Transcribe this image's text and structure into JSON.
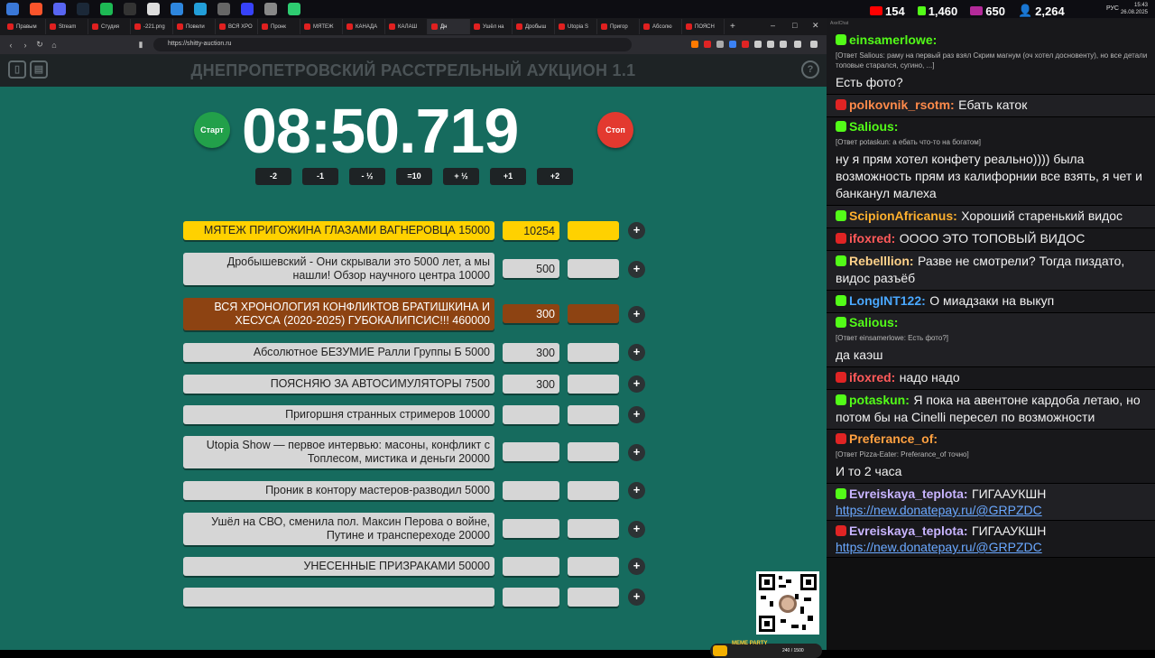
{
  "taskbar": {
    "clock": "15:43",
    "date": "26.08.2025",
    "lang": "РУС"
  },
  "browser": {
    "tabs": [
      "Правым",
      "Stream",
      "Студия",
      "-221.png",
      "Повели",
      "ВСЯ ХРО",
      "Пронк",
      "МЯТЕЖ",
      "КАНАДА",
      "КАЛАШ",
      "Дн",
      "Ушёл на",
      "Дробыш",
      "Utopia S",
      "Пригор",
      "Абсолю",
      "ПОЯСН"
    ],
    "url": "https://shitty-auction.ru"
  },
  "app": {
    "title": "ДНЕПРОПЕТРОВСКИЙ РАССТРЕЛЬНЫЙ АУКЦИОН 1.1",
    "timer": "08:50.719",
    "start": "Старт",
    "stop": "Стоп",
    "adjust": [
      "-2",
      "-1",
      "- ½",
      "=10",
      "+ ½",
      "+1",
      "+2"
    ],
    "lots": [
      {
        "name": "МЯТЕЖ ПРИГОЖИНА ГЛАЗАМИ ВАГНЕРОВЦА 15000",
        "amount": "10254"
      },
      {
        "name": "Дробышевский - Они скрывали это 5000 лет, а мы нашли! Обзор научного центра 10000",
        "amount": "500"
      },
      {
        "name": "ВСЯ ХРОНОЛОГИЯ КОНФЛИКТОВ БРАТИШКИНА И ХЕСУСА (2020-2025) ГУБОКАЛИПСИС!!! 460000",
        "amount": "300"
      },
      {
        "name": "Абсолютное БЕЗУМИЕ Ралли Группы Б 5000",
        "amount": "300"
      },
      {
        "name": "ПОЯСНЯЮ ЗА АВТОСИМУЛЯТОРЫ 7500",
        "amount": "300"
      },
      {
        "name": "Пригоршня странных стримеров 10000",
        "amount": ""
      },
      {
        "name": "Utopia Show — первое интервью: масоны, конфликт с Топлесом, мистика и деньги 20000",
        "amount": ""
      },
      {
        "name": "Проник в контору мастеров-разводил 5000",
        "amount": ""
      },
      {
        "name": "Ушёл на СВО, сменила пол. Максин Перова о войне, Путине и транспереходе 20000",
        "amount": ""
      },
      {
        "name": "УНЕСЕННЫЕ ПРИЗРАКАМИ 50000",
        "amount": ""
      },
      {
        "name": "",
        "amount": ""
      }
    ],
    "plus": "+",
    "meme": {
      "label": "MEME PARTY",
      "progress": "240 / 1500"
    }
  },
  "chat": {
    "app": "AxelChat",
    "stats": {
      "youtube": "154",
      "kick": "1,460",
      "live": "650",
      "total": "2,264"
    },
    "messages": [
      {
        "badge": "kick",
        "name": "einsamerlowe:",
        "color": "#53fc18",
        "reply": "[Ответ Salious: раму на первый раз взял Скрим магнум (оч хотел досновенту), но все детали топовые старался, сугино, ...]",
        "text": "Есть фото?"
      },
      {
        "badge": "live",
        "name": "polkovnik_rsotm:",
        "color": "#ff8a4a",
        "reply": "",
        "text": "Ебать каток"
      },
      {
        "badge": "kick",
        "name": "Salious:",
        "color": "#53fc18",
        "reply": "[Ответ potaskun: а ебать что-то на богатом]",
        "text": "ну я прям хотел конфету реально)))) была возможность прям из калифорнии все взять, я чет и банканул малеха"
      },
      {
        "badge": "kick",
        "name": "ScipionAfricanus:",
        "color": "#ffb02e",
        "reply": "",
        "text": "Хороший старенький видос"
      },
      {
        "badge": "live",
        "name": "ifoxred:",
        "color": "#ff5a5a",
        "reply": "",
        "text": "ОООО ЭТО ТОПОВЫЙ ВИДОС"
      },
      {
        "badge": "kick",
        "name": "Rebelllion:",
        "color": "#ffd28a",
        "reply": "",
        "text": "Разве не смотрели? Тогда пиздато, видос разъёб"
      },
      {
        "badge": "kick",
        "name": "LongINT122:",
        "color": "#4aa8ff",
        "reply": "",
        "text": "О миадзаки на выкуп"
      },
      {
        "badge": "kick",
        "name": "Salious:",
        "color": "#53fc18",
        "reply": "[Ответ einsamerlowe: Есть фото?]",
        "text": "да каэш"
      },
      {
        "badge": "live",
        "name": "ifoxred:",
        "color": "#ff5a5a",
        "reply": "",
        "text": "надо надо"
      },
      {
        "badge": "kick",
        "name": "potaskun:",
        "color": "#53fc18",
        "reply": "",
        "text": "Я пока на авентоне кардоба летаю, но потом бы на Cinelli пересел по возможности"
      },
      {
        "badge": "live",
        "name": "Preferance_of:",
        "color": "#ffa040",
        "reply": "[Ответ Pizza-Eater: Preferance_of точно]",
        "text": "И то 2 часа"
      },
      {
        "badge": "kick",
        "name": "Evreiskaya_teplota:",
        "color": "#c8b4ff",
        "reply": "",
        "text": "ГИГААУКШН",
        "link": "https://new.donatepay.ru/@GRPZDC"
      },
      {
        "badge": "live",
        "name": "Evreiskaya_teplota:",
        "color": "#c8b4ff",
        "reply": "",
        "text": "ГИГААУКШН",
        "link": "https://new.donatepay.ru/@GRPZDC"
      }
    ]
  }
}
